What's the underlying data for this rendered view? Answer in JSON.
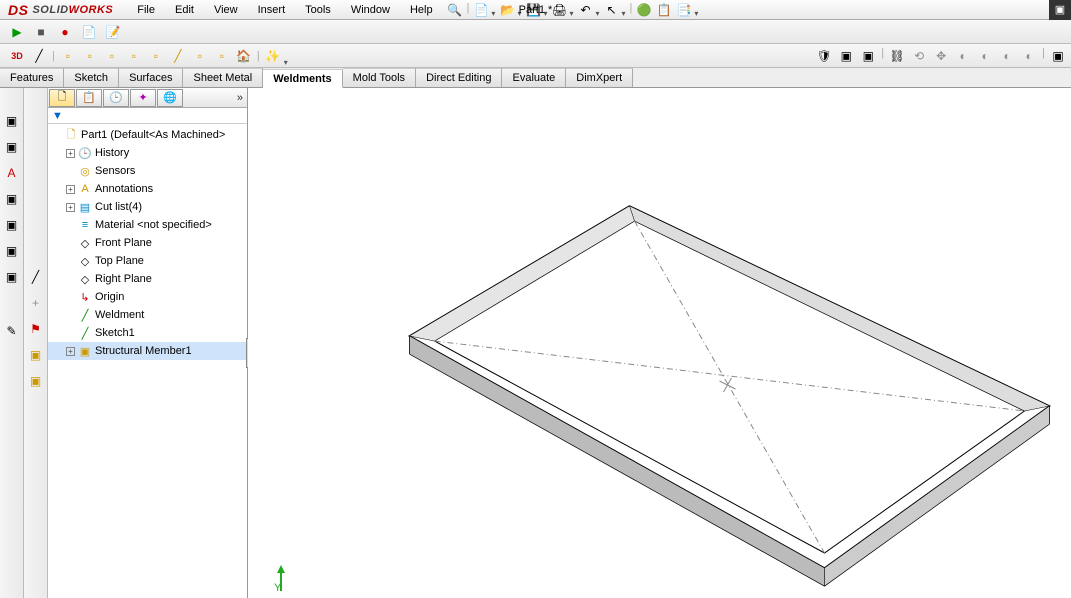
{
  "title": {
    "brand_solid": "SOLID",
    "brand_works": "WORKS"
  },
  "menu": {
    "file": "File",
    "edit": "Edit",
    "view": "View",
    "insert": "Insert",
    "tools": "Tools",
    "window": "Window",
    "help": "Help"
  },
  "doc": {
    "name": "Part1 *"
  },
  "command_tabs": {
    "features": "Features",
    "sketch": "Sketch",
    "surfaces": "Surfaces",
    "sheetmetal": "Sheet Metal",
    "weldments": "Weldments",
    "moldtools": "Mold Tools",
    "directediting": "Direct Editing",
    "evaluate": "Evaluate",
    "dimxpert": "DimXpert"
  },
  "tree": {
    "root": "Part1  (Default<As Machined>",
    "history": "History",
    "sensors": "Sensors",
    "annotations": "Annotations",
    "cutlist": "Cut list(4)",
    "material": "Material <not specified>",
    "front": "Front Plane",
    "top": "Top Plane",
    "right": "Right Plane",
    "origin": "Origin",
    "weldment": "Weldment",
    "sketch1": "Sketch1",
    "member": "Structural Member1"
  },
  "icons": {
    "search": "🔍",
    "new": "📄",
    "open": "📂",
    "save": "💾",
    "print": "🖨",
    "undo": "↶",
    "select": "↖",
    "sep": "|",
    "rebuild": "🟢",
    "options": "📋",
    "macro": "📑",
    "play": "▶",
    "stop": "■",
    "rec": "●",
    "doc": "📄",
    "edit": "📝",
    "sketch3d": "3D",
    "line": "╱",
    "box1": "▫",
    "box2": "▫",
    "box3": "▫",
    "box4": "▫",
    "box5": "▫",
    "l1": "╱",
    "box6": "▫",
    "box7": "▫",
    "home": "🏠",
    "wizard": "✨",
    "shield": "🛡",
    "cube1": "▣",
    "cube2": "▣",
    "chain": "⛓",
    "mirror": "⟲",
    "move": "✥",
    "g1": "◐",
    "g2": "◐",
    "g3": "◐",
    "g4": "◐",
    "zoomfit": "🔍",
    "zoomarea": "🔍",
    "prev": "↶",
    "sec": "▣",
    "style": "▣",
    "tri": "▾",
    "tri2": "▾",
    "hide": "👁",
    "app": "🔴",
    "app2": "⬤",
    "mon": "🖥",
    "filter": "▼",
    "tab1": "🗋",
    "tab2": "📋",
    "tab3": "🕒",
    "tab4": "✦",
    "tab5": "🌐",
    "root": "🗋",
    "hist": "🕒",
    "sensor": "◎",
    "annot": "A",
    "cut": "▤",
    "mat": "≡",
    "plane": "◇",
    "origin": "↳",
    "weld": "╱",
    "sk": "╱",
    "mem": "▣",
    "triad_y": "Y↑"
  }
}
